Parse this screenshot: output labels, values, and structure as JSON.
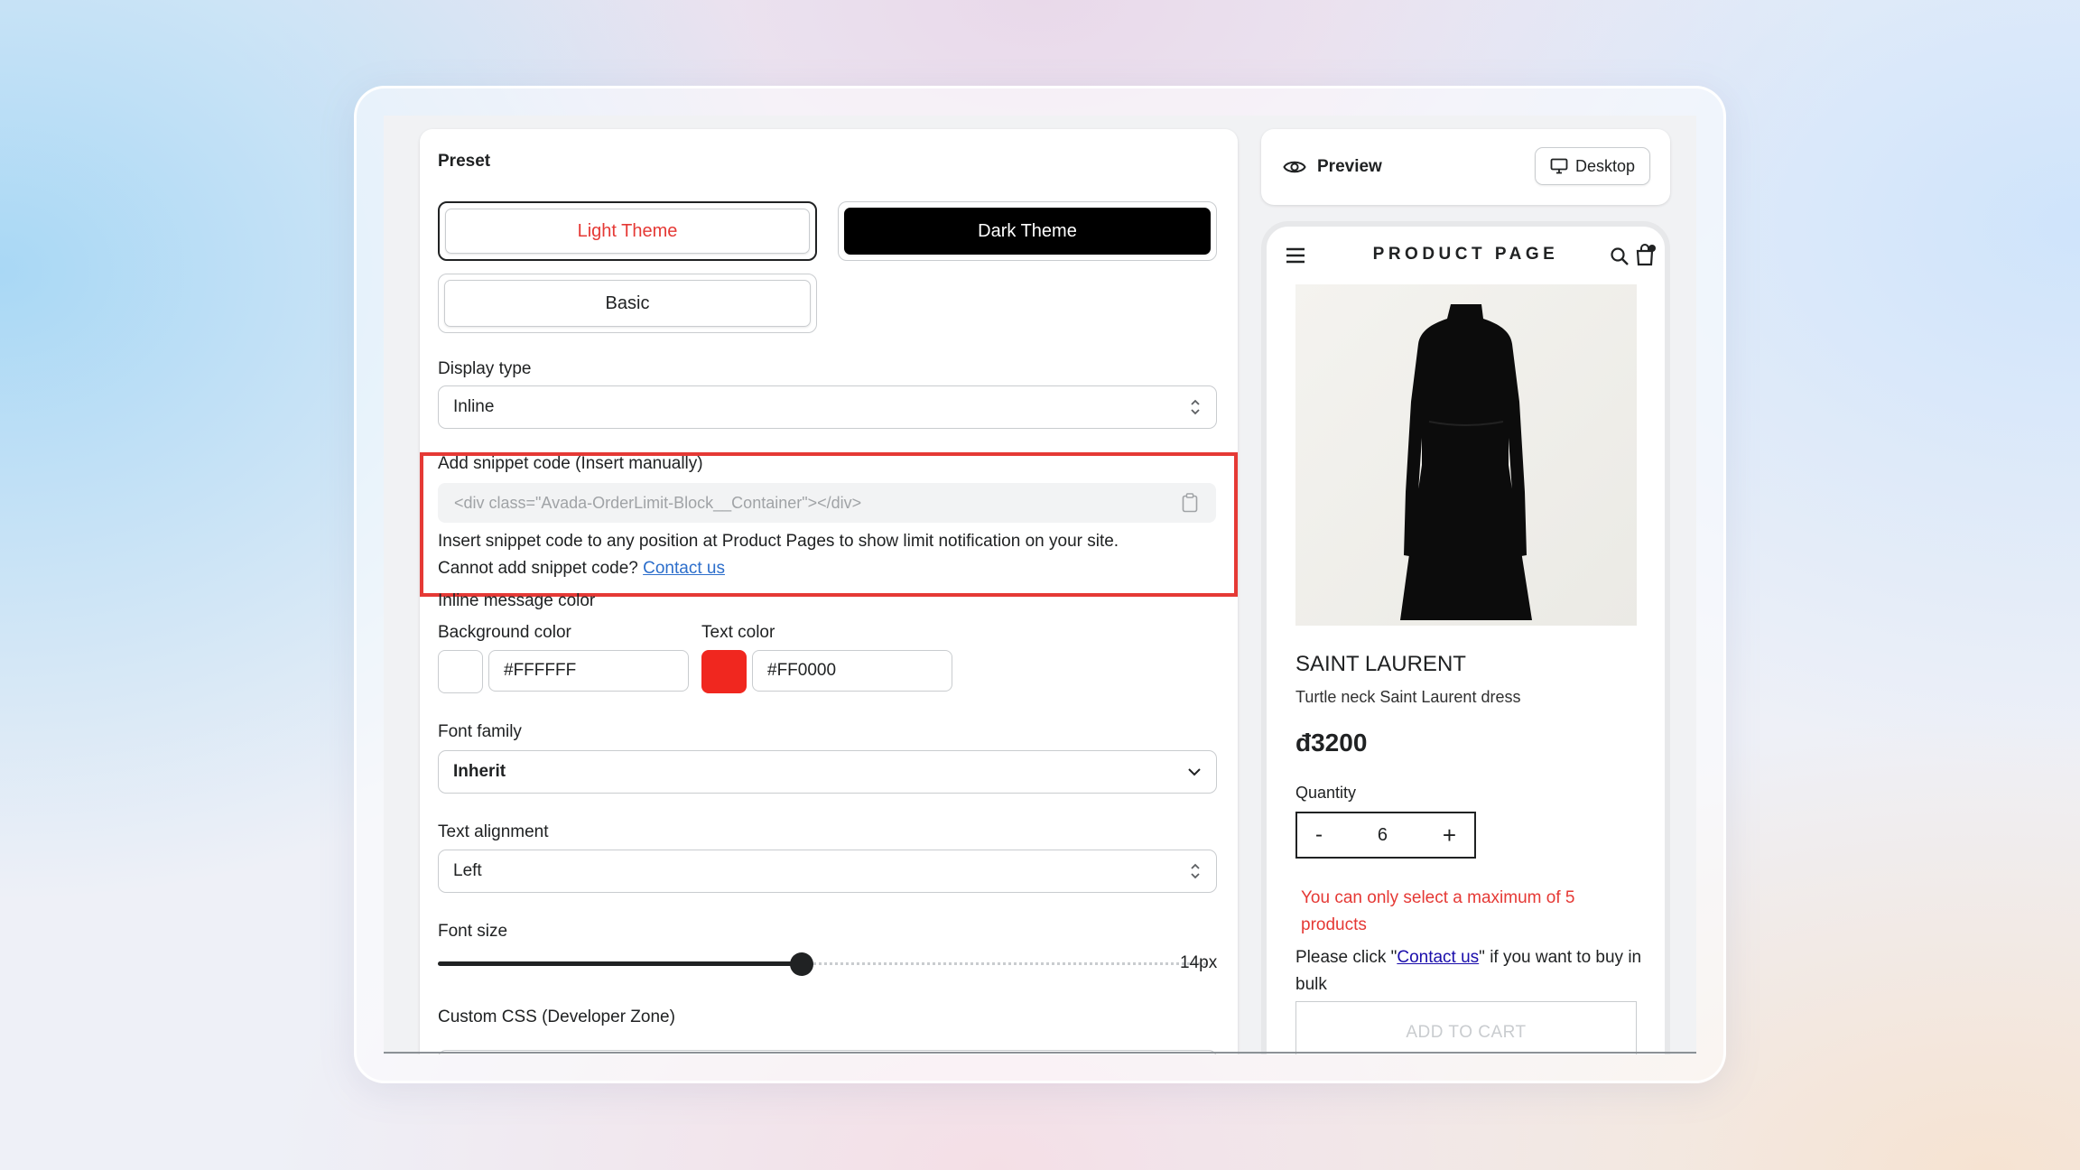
{
  "settings": {
    "preset_label": "Preset",
    "presets": [
      {
        "label": "Light Theme",
        "selected": true
      },
      {
        "label": "Dark Theme",
        "selected": false
      },
      {
        "label": "Basic",
        "selected": false
      }
    ],
    "display_type_label": "Display type",
    "display_type_value": "Inline",
    "snippet_label": "Add snippet code (Insert manually)",
    "snippet_value": "<div class=\"Avada-OrderLimit-Block__Container\"></div>",
    "snippet_help": "Insert snippet code to any position at Product Pages to show limit notification on your site.",
    "snippet_contact_prefix": "Cannot add snippet code?",
    "snippet_contact_link": "Contact us",
    "inline_color_label": "Inline message color",
    "bg_color_label": "Background color",
    "bg_color_value": "#FFFFFF",
    "text_color_label": "Text color",
    "text_color_value": "#FF0000",
    "font_family_label": "Font family",
    "font_family_value": "Inherit",
    "text_align_label": "Text alignment",
    "text_align_value": "Left",
    "font_size_label": "Font size",
    "font_size_value": "14px",
    "font_size_fraction": 0.47,
    "custom_css_label": "Custom CSS (Developer Zone)"
  },
  "preview": {
    "title": "Preview",
    "device_label": "Desktop"
  },
  "phone": {
    "store_title": "PRODUCT PAGE",
    "brand": "SAINT LAURENT",
    "product_name": "Turtle neck Saint Laurent dress",
    "price": "đ3200",
    "quantity_label": "Quantity",
    "qty_minus": "-",
    "qty_value": "6",
    "qty_plus": "+",
    "limit_message": "You can only select a maximum of 5 products",
    "bulk_prefix": "Please click \"",
    "bulk_link": "Contact us",
    "bulk_suffix": "\" if you want to buy in bulk",
    "add_to_cart": "ADD TO CART"
  },
  "colors": {
    "accent_red": "#e53935",
    "limit_red": "#e53935",
    "link_blue": "#2c6ecb",
    "phone_link": "#1a0dab"
  }
}
